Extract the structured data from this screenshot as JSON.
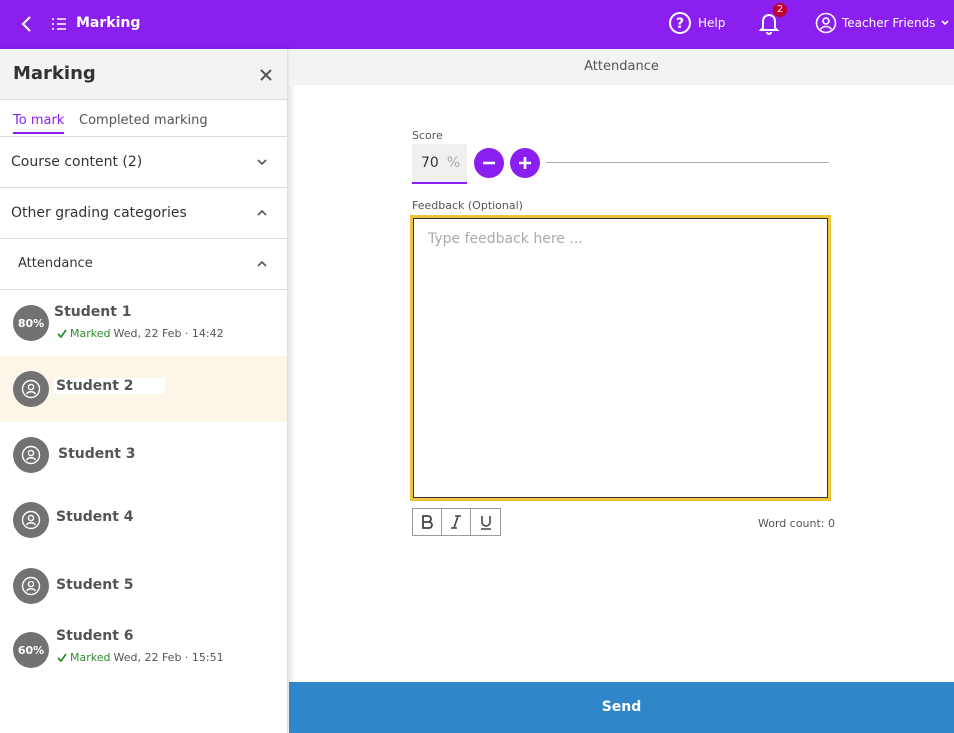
{
  "topbar": {
    "title": "Marking",
    "help_label": "Help",
    "notification_count": "2",
    "user_name": "Teacher Friends"
  },
  "sidebar": {
    "title": "Marking",
    "tabs": [
      {
        "label": "To mark"
      },
      {
        "label": "Completed marking"
      }
    ],
    "sections": [
      {
        "label": "Course content (2)"
      },
      {
        "label": "Other grading categories"
      },
      {
        "label": "Attendance"
      }
    ],
    "students": [
      {
        "name": "Student 1",
        "avatar_text": "80%",
        "marked_label": "Marked",
        "marked_time": "Wed, 22 Feb · 14:42"
      },
      {
        "name": "Student 2"
      },
      {
        "name": "Student 3"
      },
      {
        "name": "Student 4"
      },
      {
        "name": "Student 5"
      },
      {
        "name": "Student 6",
        "avatar_text": "60%",
        "marked_label": "Marked",
        "marked_time": "Wed, 22 Feb · 15:51"
      }
    ]
  },
  "main": {
    "header": "Attendance",
    "score_label": "Score",
    "score_value": "70",
    "score_unit": "%",
    "feedback_label": "Feedback (Optional)",
    "feedback_placeholder": "Type feedback here ...",
    "word_count": "Word count: 0",
    "send_label": "Send"
  },
  "colors": {
    "brand": "#8a1ff0",
    "send": "#2f86c9",
    "focus": "#f0c33c",
    "selected_row": "#fbf6e8",
    "marked": "#2e8b2e"
  }
}
